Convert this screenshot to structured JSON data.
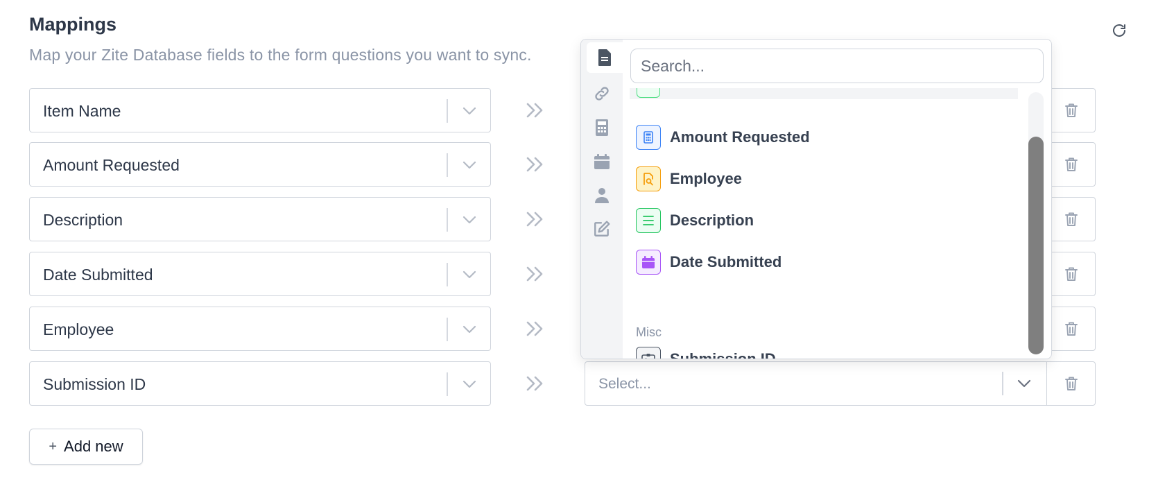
{
  "header": {
    "title": "Mappings",
    "subtitle": "Map your Zite Database fields to the form questions you want to sync."
  },
  "rows": [
    {
      "source": "Item Name"
    },
    {
      "source": "Amount Requested"
    },
    {
      "source": "Description"
    },
    {
      "source": "Date Submitted"
    },
    {
      "source": "Employee"
    },
    {
      "source": "Submission ID",
      "target_placeholder": "Select..."
    }
  ],
  "add_button": {
    "icon": "plus-icon",
    "label": "Add new"
  },
  "dropdown": {
    "search_placeholder": "Search...",
    "rail": [
      {
        "icon": "document-icon",
        "active": true
      },
      {
        "icon": "link-icon"
      },
      {
        "icon": "calculator-icon"
      },
      {
        "icon": "calendar-icon"
      },
      {
        "icon": "person-icon"
      },
      {
        "icon": "edit-icon"
      }
    ],
    "items": [
      {
        "label": "Amount Requested",
        "icon": "calculator-icon",
        "color": "#3b82f6"
      },
      {
        "label": "Employee",
        "icon": "person-search-icon",
        "color": "#f59e0b"
      },
      {
        "label": "Description",
        "icon": "lines-icon",
        "color": "#22c55e"
      },
      {
        "label": "Date Submitted",
        "icon": "calendar-icon",
        "color": "#a855f7"
      }
    ],
    "group_label": "Misc",
    "misc_items": [
      {
        "label": "Submission ID",
        "icon": "id-card-icon",
        "color": "#4b5563"
      }
    ]
  },
  "colors": {
    "border": "#cfd4dc",
    "muted_text": "#8a94a6",
    "icon_gray": "#9aa3b2"
  }
}
